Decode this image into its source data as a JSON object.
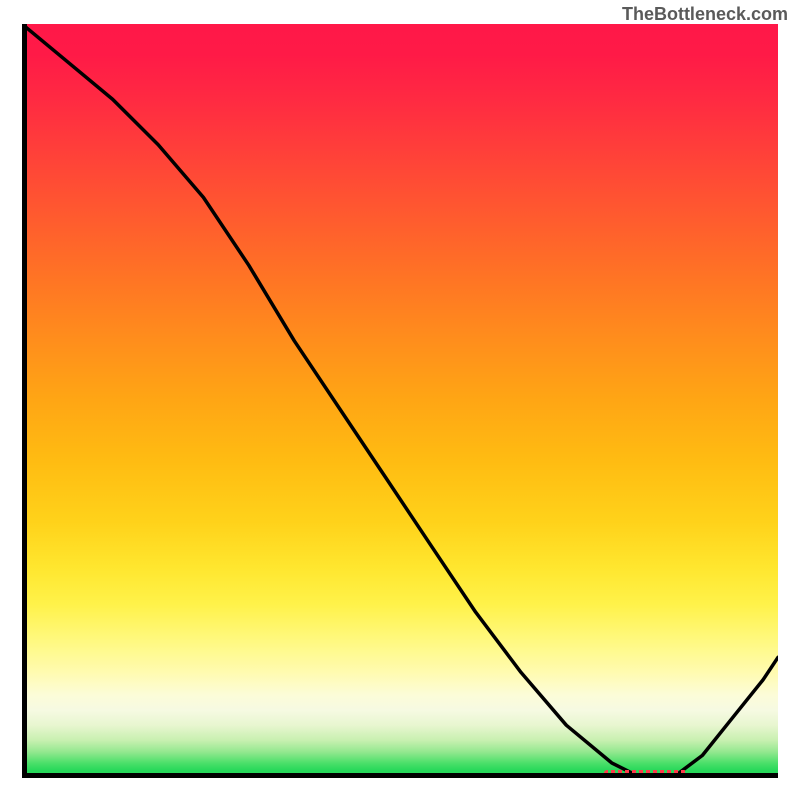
{
  "watermark_text": "TheBottleneck.com",
  "chart_data": {
    "type": "line",
    "title": "",
    "xlabel": "",
    "ylabel": "",
    "xlim": [
      0,
      100
    ],
    "ylim": [
      0,
      100
    ],
    "series": [
      {
        "name": "bottleneck-curve",
        "x": [
          0,
          6,
          12,
          18,
          24,
          30,
          36,
          42,
          48,
          54,
          60,
          66,
          72,
          78,
          82,
          86,
          90,
          94,
          98,
          100
        ],
        "values": [
          100,
          95,
          90,
          84,
          77,
          68,
          58,
          49,
          40,
          31,
          22,
          14,
          7,
          2,
          0,
          0,
          3,
          8,
          13,
          16
        ]
      }
    ],
    "valley_marker": {
      "x_start": 77,
      "x_end": 88
    },
    "colors": {
      "curve": "#000000",
      "valley_marker": "#ff3a4a",
      "gradient_top": "#ff1848",
      "gradient_bottom": "#27d85a",
      "frame": "#000000"
    }
  }
}
